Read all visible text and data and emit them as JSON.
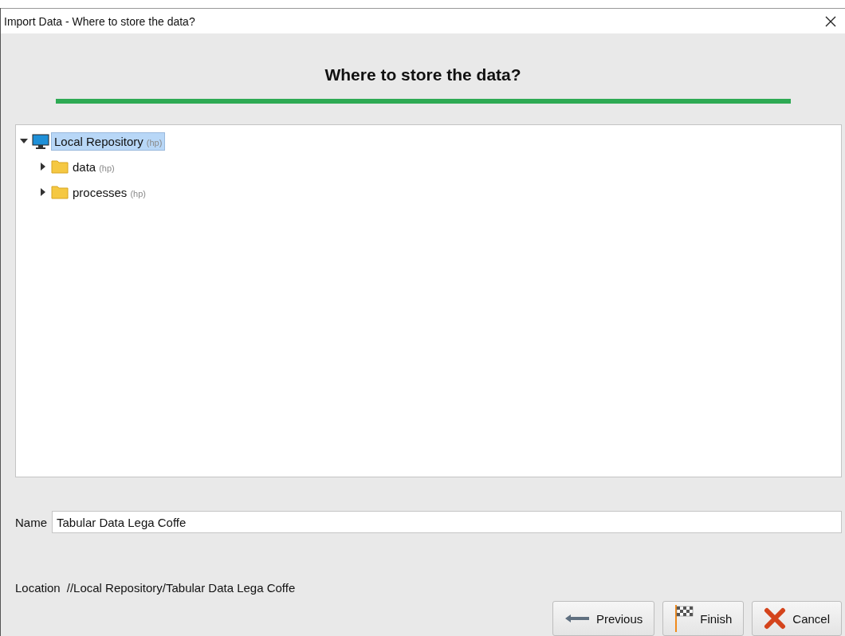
{
  "window": {
    "title": "Import Data - Where to store the data?"
  },
  "header": {
    "title": "Where to store the data?"
  },
  "tree": [
    {
      "label": "Local Repository",
      "owner": "(hp)",
      "kind": "repository",
      "expanded": true,
      "selected": true,
      "children": [
        {
          "label": "data",
          "owner": "(hp)",
          "kind": "folder",
          "expanded": false,
          "selected": false
        },
        {
          "label": "processes",
          "owner": "(hp)",
          "kind": "folder",
          "expanded": false,
          "selected": false
        }
      ]
    }
  ],
  "name_field": {
    "label": "Name",
    "value": "Tabular Data Lega Coffe"
  },
  "location": {
    "label": "Location",
    "value": "//Local Repository/Tabular Data Lega Coffe"
  },
  "buttons": [
    {
      "label": "Previous",
      "kind": "previous"
    },
    {
      "label": "Finish",
      "kind": "finish"
    },
    {
      "label": "Cancel",
      "kind": "cancel"
    }
  ]
}
